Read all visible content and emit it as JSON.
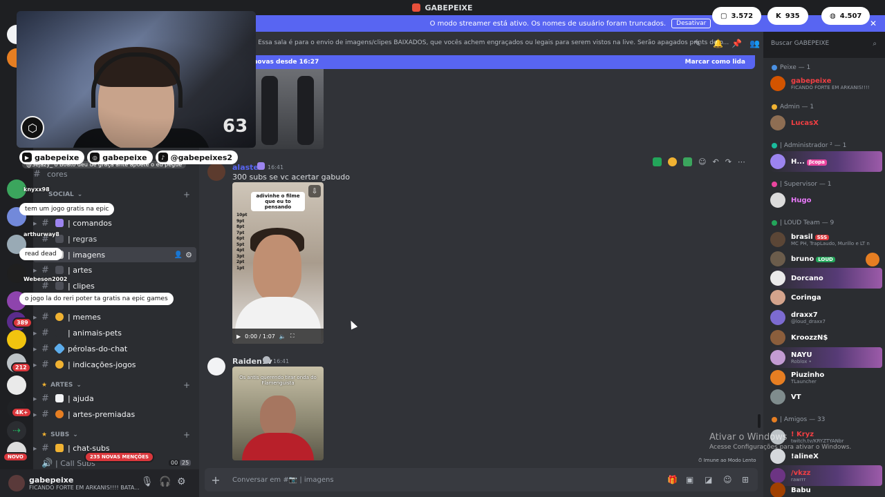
{
  "window": {
    "title": "GABEPEIXE"
  },
  "streamer_bar": {
    "message": "O modo streamer está ativo. Os nomes de usuário foram truncados.",
    "button": "Desativar",
    "close": "✕"
  },
  "counters": [
    {
      "icon": "twitch-icon",
      "value": "3.572"
    },
    {
      "icon": "kick-icon",
      "value": "935"
    },
    {
      "icon": "globe-icon",
      "value": "4.507"
    }
  ],
  "channel_header": {
    "name": "ns",
    "topic": "Essa sala é para o envio de imagens/clipes BAIXADOS, que vocês achem engraçados ou legais para serem vistos na live. Serão apagados prints de o...",
    "search_placeholder": "Buscar GABEPEIXE"
  },
  "new_messages_bar": {
    "label": "novas desde 16:27",
    "action": "Marcar como lida"
  },
  "webcam": {
    "counter": "63"
  },
  "socials": [
    {
      "icon": "youtube-icon",
      "handle": "gabepeixe"
    },
    {
      "icon": "instagram-icon",
      "handle": "gabepeixe"
    },
    {
      "icon": "tiktok-icon",
      "handle": "@gabepeixes2"
    }
  ],
  "overlay_chat": [
    {
      "user": "knyxx98",
      "text": "tem um jogo gratis na epic"
    },
    {
      "user": "arthurway8",
      "text": "read dead"
    },
    {
      "user": "Webeson2002",
      "text": "o jogo la do reri poter ta gratis na epic games"
    }
  ],
  "overlay_fragment": "@Sejazy_ o Boato deu de graça ante apoete o eu pegue",
  "sidebar": {
    "channels_top": [
      {
        "name": "cores"
      }
    ],
    "category_social": "SOCIAL",
    "channels_social": [
      {
        "name": "| comandos"
      },
      {
        "name": "| regras"
      },
      {
        "name": "| imagens",
        "active": true
      },
      {
        "name": "| artes"
      },
      {
        "name": "| clipes"
      },
      {
        "name": "| memes"
      },
      {
        "name": "| animais-pets"
      },
      {
        "name": "pérolas-do-chat"
      },
      {
        "name": "| indicações-jogos"
      }
    ],
    "category_artes": "ARTES",
    "channels_artes": [
      {
        "name": "| ajuda"
      },
      {
        "name": "| artes-premiadas"
      }
    ],
    "category_subs": "SUBS",
    "channels_subs": [
      {
        "name": "| chat-subs"
      },
      {
        "name": "| Call Subs",
        "count_a": "00",
        "count_b": "25"
      }
    ],
    "mentions_badge": "235 NOVAS MENÇÕES",
    "new_badge": "NOVO"
  },
  "server_badges": [
    "389",
    "212",
    "4K+"
  ],
  "user_panel": {
    "name": "gabepeixe",
    "status": "FICANDO FORTE EM ARKANIS!!!! BATA..."
  },
  "messages": [
    {
      "author": "alaster",
      "time": "16:41",
      "text": "300 subs se vc acertar gabudo",
      "video": {
        "caption": "adivinhe o filme que eu to pensando",
        "list": [
          "10pt",
          "9pt",
          "8pt",
          "7pt",
          "6pt",
          "5pt",
          "4pt",
          "3pt",
          "2pt",
          "1pt"
        ],
        "time": "0:00 / 1:07"
      }
    },
    {
      "author": "Raiden1v",
      "time": "16:41",
      "text": "",
      "video": {
        "caption": "Os antis querendo tirar onda do Flamenguista"
      }
    }
  ],
  "composer": {
    "placeholder": "Conversar em #📷 | imagens"
  },
  "slow_mode": "Imune ao Modo Lento",
  "activate_windows": {
    "title": "Ativar o Windows",
    "subtitle": "Acesse Configurações para ativar o Windows."
  },
  "members": {
    "groups": [
      {
        "label": "Peixe — 1"
      },
      {
        "label": "Admin — 1"
      },
      {
        "label": "| Administrador ² — 1"
      },
      {
        "label": "| Supervisor — 1"
      },
      {
        "label": "| LOUD Team — 9"
      },
      {
        "label": "| Amigos — 33"
      }
    ],
    "people": [
      {
        "name": "gabepeixe",
        "status": "FICANDO FORTE EM ARKANIS!!!!",
        "color": "#f23f43"
      },
      {
        "name": "LucasX",
        "status": "",
        "color": "#f23f43"
      },
      {
        "name": "H...",
        "status": "",
        "color": "#ffffff",
        "tag": "ꞵcopa"
      },
      {
        "name": "Hugo",
        "status": "",
        "color": "#e879f9"
      },
      {
        "name": "brasil",
        "status": "MC PH, TrapLaudo, Murillo e LT n",
        "color": "#ffffff",
        "tag": "SSS"
      },
      {
        "name": "bruno",
        "status": "",
        "color": "#ffffff",
        "tag": "LOUD"
      },
      {
        "name": "Dorcano",
        "status": "",
        "color": "#ffffff"
      },
      {
        "name": "Coringa",
        "status": "",
        "color": "#ffffff"
      },
      {
        "name": "draxx7",
        "status": "@loud_draxx7",
        "color": "#ffffff"
      },
      {
        "name": "KroozzN$",
        "status": "",
        "color": "#ffffff"
      },
      {
        "name": "NAYU",
        "status": "Roblox •",
        "color": "#ffffff"
      },
      {
        "name": "Piuzinho",
        "status": "TLauncher",
        "color": "#ffffff"
      },
      {
        "name": "VT",
        "status": "",
        "color": "#ffffff"
      },
      {
        "name": "! Kryz",
        "status": "twitch.tv/KRYZTYANbr",
        "color": "#f23f43"
      },
      {
        "name": "!alineX",
        "status": "",
        "color": "#ffffff"
      },
      {
        "name": "/vkzz",
        "status": "rawrrr",
        "color": "#f23f43"
      },
      {
        "name": "Babu",
        "status": "",
        "color": "#ffffff"
      }
    ]
  },
  "colors": {
    "blurple": "#5865f2",
    "background": "#313338",
    "sidebar": "#2b2d31"
  }
}
